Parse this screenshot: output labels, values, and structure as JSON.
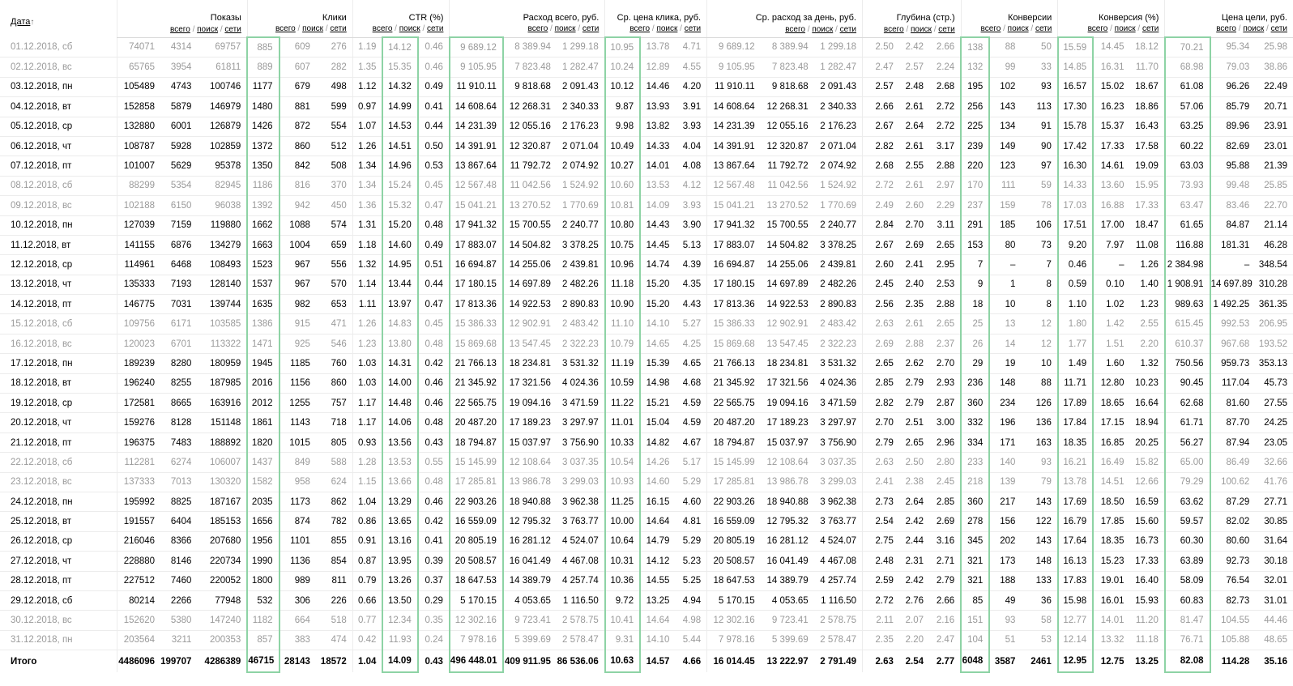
{
  "sort_arrow": "↑",
  "sub_labels": {
    "all": "всего",
    "search": "поиск",
    "net": "сети",
    "slash": "/"
  },
  "headers": [
    "Дата",
    "Показы",
    "Клики",
    "CTR (%)",
    "Расход всего, руб.",
    "Ср. цена клика, руб.",
    "Ср. расход за день, руб.",
    "Глубина (стр.)",
    "Конверсии",
    "Конверсия (%)",
    "Цена цели, руб."
  ],
  "rows": [
    {
      "w": 1,
      "c": [
        "01.12.2018, сб",
        "74071",
        "4314",
        "69757",
        "885",
        "609",
        "276",
        "1.19",
        "14.12",
        "0.46",
        "9 689.12",
        "8 389.94",
        "1 299.18",
        "10.95",
        "13.78",
        "4.71",
        "9 689.12",
        "8 389.94",
        "1 299.18",
        "2.50",
        "2.42",
        "2.66",
        "138",
        "88",
        "50",
        "15.59",
        "14.45",
        "18.12",
        "70.21",
        "95.34",
        "25.98"
      ]
    },
    {
      "w": 1,
      "c": [
        "02.12.2018, вс",
        "65765",
        "3954",
        "61811",
        "889",
        "607",
        "282",
        "1.35",
        "15.35",
        "0.46",
        "9 105.95",
        "7 823.48",
        "1 282.47",
        "10.24",
        "12.89",
        "4.55",
        "9 105.95",
        "7 823.48",
        "1 282.47",
        "2.47",
        "2.57",
        "2.24",
        "132",
        "99",
        "33",
        "14.85",
        "16.31",
        "11.70",
        "68.98",
        "79.03",
        "38.86"
      ]
    },
    {
      "w": 0,
      "c": [
        "03.12.2018, пн",
        "105489",
        "4743",
        "100746",
        "1177",
        "679",
        "498",
        "1.12",
        "14.32",
        "0.49",
        "11 910.11",
        "9 818.68",
        "2 091.43",
        "10.12",
        "14.46",
        "4.20",
        "11 910.11",
        "9 818.68",
        "2 091.43",
        "2.57",
        "2.48",
        "2.68",
        "195",
        "102",
        "93",
        "16.57",
        "15.02",
        "18.67",
        "61.08",
        "96.26",
        "22.49"
      ]
    },
    {
      "w": 0,
      "c": [
        "04.12.2018, вт",
        "152858",
        "5879",
        "146979",
        "1480",
        "881",
        "599",
        "0.97",
        "14.99",
        "0.41",
        "14 608.64",
        "12 268.31",
        "2 340.33",
        "9.87",
        "13.93",
        "3.91",
        "14 608.64",
        "12 268.31",
        "2 340.33",
        "2.66",
        "2.61",
        "2.72",
        "256",
        "143",
        "113",
        "17.30",
        "16.23",
        "18.86",
        "57.06",
        "85.79",
        "20.71"
      ]
    },
    {
      "w": 0,
      "c": [
        "05.12.2018, ср",
        "132880",
        "6001",
        "126879",
        "1426",
        "872",
        "554",
        "1.07",
        "14.53",
        "0.44",
        "14 231.39",
        "12 055.16",
        "2 176.23",
        "9.98",
        "13.82",
        "3.93",
        "14 231.39",
        "12 055.16",
        "2 176.23",
        "2.67",
        "2.64",
        "2.72",
        "225",
        "134",
        "91",
        "15.78",
        "15.37",
        "16.43",
        "63.25",
        "89.96",
        "23.91"
      ]
    },
    {
      "w": 0,
      "c": [
        "06.12.2018, чт",
        "108787",
        "5928",
        "102859",
        "1372",
        "860",
        "512",
        "1.26",
        "14.51",
        "0.50",
        "14 391.91",
        "12 320.87",
        "2 071.04",
        "10.49",
        "14.33",
        "4.04",
        "14 391.91",
        "12 320.87",
        "2 071.04",
        "2.82",
        "2.61",
        "3.17",
        "239",
        "149",
        "90",
        "17.42",
        "17.33",
        "17.58",
        "60.22",
        "82.69",
        "23.01"
      ]
    },
    {
      "w": 0,
      "c": [
        "07.12.2018, пт",
        "101007",
        "5629",
        "95378",
        "1350",
        "842",
        "508",
        "1.34",
        "14.96",
        "0.53",
        "13 867.64",
        "11 792.72",
        "2 074.92",
        "10.27",
        "14.01",
        "4.08",
        "13 867.64",
        "11 792.72",
        "2 074.92",
        "2.68",
        "2.55",
        "2.88",
        "220",
        "123",
        "97",
        "16.30",
        "14.61",
        "19.09",
        "63.03",
        "95.88",
        "21.39"
      ]
    },
    {
      "w": 1,
      "c": [
        "08.12.2018, сб",
        "88299",
        "5354",
        "82945",
        "1186",
        "816",
        "370",
        "1.34",
        "15.24",
        "0.45",
        "12 567.48",
        "11 042.56",
        "1 524.92",
        "10.60",
        "13.53",
        "4.12",
        "12 567.48",
        "11 042.56",
        "1 524.92",
        "2.72",
        "2.61",
        "2.97",
        "170",
        "111",
        "59",
        "14.33",
        "13.60",
        "15.95",
        "73.93",
        "99.48",
        "25.85"
      ]
    },
    {
      "w": 1,
      "c": [
        "09.12.2018, вс",
        "102188",
        "6150",
        "96038",
        "1392",
        "942",
        "450",
        "1.36",
        "15.32",
        "0.47",
        "15 041.21",
        "13 270.52",
        "1 770.69",
        "10.81",
        "14.09",
        "3.93",
        "15 041.21",
        "13 270.52",
        "1 770.69",
        "2.49",
        "2.60",
        "2.29",
        "237",
        "159",
        "78",
        "17.03",
        "16.88",
        "17.33",
        "63.47",
        "83.46",
        "22.70"
      ]
    },
    {
      "w": 0,
      "c": [
        "10.12.2018, пн",
        "127039",
        "7159",
        "119880",
        "1662",
        "1088",
        "574",
        "1.31",
        "15.20",
        "0.48",
        "17 941.32",
        "15 700.55",
        "2 240.77",
        "10.80",
        "14.43",
        "3.90",
        "17 941.32",
        "15 700.55",
        "2 240.77",
        "2.84",
        "2.70",
        "3.11",
        "291",
        "185",
        "106",
        "17.51",
        "17.00",
        "18.47",
        "61.65",
        "84.87",
        "21.14"
      ]
    },
    {
      "w": 0,
      "c": [
        "11.12.2018, вт",
        "141155",
        "6876",
        "134279",
        "1663",
        "1004",
        "659",
        "1.18",
        "14.60",
        "0.49",
        "17 883.07",
        "14 504.82",
        "3 378.25",
        "10.75",
        "14.45",
        "5.13",
        "17 883.07",
        "14 504.82",
        "3 378.25",
        "2.67",
        "2.69",
        "2.65",
        "153",
        "80",
        "73",
        "9.20",
        "7.97",
        "11.08",
        "116.88",
        "181.31",
        "46.28"
      ]
    },
    {
      "w": 0,
      "c": [
        "12.12.2018, ср",
        "114961",
        "6468",
        "108493",
        "1523",
        "967",
        "556",
        "1.32",
        "14.95",
        "0.51",
        "16 694.87",
        "14 255.06",
        "2 439.81",
        "10.96",
        "14.74",
        "4.39",
        "16 694.87",
        "14 255.06",
        "2 439.81",
        "2.60",
        "2.41",
        "2.95",
        "7",
        "–",
        "7",
        "0.46",
        "–",
        "1.26",
        "2 384.98",
        "–",
        "348.54"
      ]
    },
    {
      "w": 0,
      "c": [
        "13.12.2018, чт",
        "135333",
        "7193",
        "128140",
        "1537",
        "967",
        "570",
        "1.14",
        "13.44",
        "0.44",
        "17 180.15",
        "14 697.89",
        "2 482.26",
        "11.18",
        "15.20",
        "4.35",
        "17 180.15",
        "14 697.89",
        "2 482.26",
        "2.45",
        "2.40",
        "2.53",
        "9",
        "1",
        "8",
        "0.59",
        "0.10",
        "1.40",
        "1 908.91",
        "14 697.89",
        "310.28"
      ]
    },
    {
      "w": 0,
      "c": [
        "14.12.2018, пт",
        "146775",
        "7031",
        "139744",
        "1635",
        "982",
        "653",
        "1.11",
        "13.97",
        "0.47",
        "17 813.36",
        "14 922.53",
        "2 890.83",
        "10.90",
        "15.20",
        "4.43",
        "17 813.36",
        "14 922.53",
        "2 890.83",
        "2.56",
        "2.35",
        "2.88",
        "18",
        "10",
        "8",
        "1.10",
        "1.02",
        "1.23",
        "989.63",
        "1 492.25",
        "361.35"
      ]
    },
    {
      "w": 1,
      "c": [
        "15.12.2018, сб",
        "109756",
        "6171",
        "103585",
        "1386",
        "915",
        "471",
        "1.26",
        "14.83",
        "0.45",
        "15 386.33",
        "12 902.91",
        "2 483.42",
        "11.10",
        "14.10",
        "5.27",
        "15 386.33",
        "12 902.91",
        "2 483.42",
        "2.63",
        "2.61",
        "2.65",
        "25",
        "13",
        "12",
        "1.80",
        "1.42",
        "2.55",
        "615.45",
        "992.53",
        "206.95"
      ]
    },
    {
      "w": 1,
      "c": [
        "16.12.2018, вс",
        "120023",
        "6701",
        "113322",
        "1471",
        "925",
        "546",
        "1.23",
        "13.80",
        "0.48",
        "15 869.68",
        "13 547.45",
        "2 322.23",
        "10.79",
        "14.65",
        "4.25",
        "15 869.68",
        "13 547.45",
        "2 322.23",
        "2.69",
        "2.88",
        "2.37",
        "26",
        "14",
        "12",
        "1.77",
        "1.51",
        "2.20",
        "610.37",
        "967.68",
        "193.52"
      ]
    },
    {
      "w": 0,
      "c": [
        "17.12.2018, пн",
        "189239",
        "8280",
        "180959",
        "1945",
        "1185",
        "760",
        "1.03",
        "14.31",
        "0.42",
        "21 766.13",
        "18 234.81",
        "3 531.32",
        "11.19",
        "15.39",
        "4.65",
        "21 766.13",
        "18 234.81",
        "3 531.32",
        "2.65",
        "2.62",
        "2.70",
        "29",
        "19",
        "10",
        "1.49",
        "1.60",
        "1.32",
        "750.56",
        "959.73",
        "353.13"
      ]
    },
    {
      "w": 0,
      "c": [
        "18.12.2018, вт",
        "196240",
        "8255",
        "187985",
        "2016",
        "1156",
        "860",
        "1.03",
        "14.00",
        "0.46",
        "21 345.92",
        "17 321.56",
        "4 024.36",
        "10.59",
        "14.98",
        "4.68",
        "21 345.92",
        "17 321.56",
        "4 024.36",
        "2.85",
        "2.79",
        "2.93",
        "236",
        "148",
        "88",
        "11.71",
        "12.80",
        "10.23",
        "90.45",
        "117.04",
        "45.73"
      ]
    },
    {
      "w": 0,
      "c": [
        "19.12.2018, ср",
        "172581",
        "8665",
        "163916",
        "2012",
        "1255",
        "757",
        "1.17",
        "14.48",
        "0.46",
        "22 565.75",
        "19 094.16",
        "3 471.59",
        "11.22",
        "15.21",
        "4.59",
        "22 565.75",
        "19 094.16",
        "3 471.59",
        "2.82",
        "2.79",
        "2.87",
        "360",
        "234",
        "126",
        "17.89",
        "18.65",
        "16.64",
        "62.68",
        "81.60",
        "27.55"
      ]
    },
    {
      "w": 0,
      "c": [
        "20.12.2018, чт",
        "159276",
        "8128",
        "151148",
        "1861",
        "1143",
        "718",
        "1.17",
        "14.06",
        "0.48",
        "20 487.20",
        "17 189.23",
        "3 297.97",
        "11.01",
        "15.04",
        "4.59",
        "20 487.20",
        "17 189.23",
        "3 297.97",
        "2.70",
        "2.51",
        "3.00",
        "332",
        "196",
        "136",
        "17.84",
        "17.15",
        "18.94",
        "61.71",
        "87.70",
        "24.25"
      ]
    },
    {
      "w": 0,
      "c": [
        "21.12.2018, пт",
        "196375",
        "7483",
        "188892",
        "1820",
        "1015",
        "805",
        "0.93",
        "13.56",
        "0.43",
        "18 794.87",
        "15 037.97",
        "3 756.90",
        "10.33",
        "14.82",
        "4.67",
        "18 794.87",
        "15 037.97",
        "3 756.90",
        "2.79",
        "2.65",
        "2.96",
        "334",
        "171",
        "163",
        "18.35",
        "16.85",
        "20.25",
        "56.27",
        "87.94",
        "23.05"
      ]
    },
    {
      "w": 1,
      "c": [
        "22.12.2018, сб",
        "112281",
        "6274",
        "106007",
        "1437",
        "849",
        "588",
        "1.28",
        "13.53",
        "0.55",
        "15 145.99",
        "12 108.64",
        "3 037.35",
        "10.54",
        "14.26",
        "5.17",
        "15 145.99",
        "12 108.64",
        "3 037.35",
        "2.63",
        "2.50",
        "2.80",
        "233",
        "140",
        "93",
        "16.21",
        "16.49",
        "15.82",
        "65.00",
        "86.49",
        "32.66"
      ]
    },
    {
      "w": 1,
      "c": [
        "23.12.2018, вс",
        "137333",
        "7013",
        "130320",
        "1582",
        "958",
        "624",
        "1.15",
        "13.66",
        "0.48",
        "17 285.81",
        "13 986.78",
        "3 299.03",
        "10.93",
        "14.60",
        "5.29",
        "17 285.81",
        "13 986.78",
        "3 299.03",
        "2.41",
        "2.38",
        "2.45",
        "218",
        "139",
        "79",
        "13.78",
        "14.51",
        "12.66",
        "79.29",
        "100.62",
        "41.76"
      ]
    },
    {
      "w": 0,
      "c": [
        "24.12.2018, пн",
        "195992",
        "8825",
        "187167",
        "2035",
        "1173",
        "862",
        "1.04",
        "13.29",
        "0.46",
        "22 903.26",
        "18 940.88",
        "3 962.38",
        "11.25",
        "16.15",
        "4.60",
        "22 903.26",
        "18 940.88",
        "3 962.38",
        "2.73",
        "2.64",
        "2.85",
        "360",
        "217",
        "143",
        "17.69",
        "18.50",
        "16.59",
        "63.62",
        "87.29",
        "27.71"
      ]
    },
    {
      "w": 0,
      "c": [
        "25.12.2018, вт",
        "191557",
        "6404",
        "185153",
        "1656",
        "874",
        "782",
        "0.86",
        "13.65",
        "0.42",
        "16 559.09",
        "12 795.32",
        "3 763.77",
        "10.00",
        "14.64",
        "4.81",
        "16 559.09",
        "12 795.32",
        "3 763.77",
        "2.54",
        "2.42",
        "2.69",
        "278",
        "156",
        "122",
        "16.79",
        "17.85",
        "15.60",
        "59.57",
        "82.02",
        "30.85"
      ]
    },
    {
      "w": 0,
      "c": [
        "26.12.2018, ср",
        "216046",
        "8366",
        "207680",
        "1956",
        "1101",
        "855",
        "0.91",
        "13.16",
        "0.41",
        "20 805.19",
        "16 281.12",
        "4 524.07",
        "10.64",
        "14.79",
        "5.29",
        "20 805.19",
        "16 281.12",
        "4 524.07",
        "2.75",
        "2.44",
        "3.16",
        "345",
        "202",
        "143",
        "17.64",
        "18.35",
        "16.73",
        "60.30",
        "80.60",
        "31.64"
      ]
    },
    {
      "w": 0,
      "c": [
        "27.12.2018, чт",
        "228880",
        "8146",
        "220734",
        "1990",
        "1136",
        "854",
        "0.87",
        "13.95",
        "0.39",
        "20 508.57",
        "16 041.49",
        "4 467.08",
        "10.31",
        "14.12",
        "5.23",
        "20 508.57",
        "16 041.49",
        "4 467.08",
        "2.48",
        "2.31",
        "2.71",
        "321",
        "173",
        "148",
        "16.13",
        "15.23",
        "17.33",
        "63.89",
        "92.73",
        "30.18"
      ]
    },
    {
      "w": 0,
      "c": [
        "28.12.2018, пт",
        "227512",
        "7460",
        "220052",
        "1800",
        "989",
        "811",
        "0.79",
        "13.26",
        "0.37",
        "18 647.53",
        "14 389.79",
        "4 257.74",
        "10.36",
        "14.55",
        "5.25",
        "18 647.53",
        "14 389.79",
        "4 257.74",
        "2.59",
        "2.42",
        "2.79",
        "321",
        "188",
        "133",
        "17.83",
        "19.01",
        "16.40",
        "58.09",
        "76.54",
        "32.01"
      ]
    },
    {
      "w": 0,
      "c": [
        "29.12.2018, сб",
        "80214",
        "2266",
        "77948",
        "532",
        "306",
        "226",
        "0.66",
        "13.50",
        "0.29",
        "5 170.15",
        "4 053.65",
        "1 116.50",
        "9.72",
        "13.25",
        "4.94",
        "5 170.15",
        "4 053.65",
        "1 116.50",
        "2.72",
        "2.76",
        "2.66",
        "85",
        "49",
        "36",
        "15.98",
        "16.01",
        "15.93",
        "60.83",
        "82.73",
        "31.01"
      ]
    },
    {
      "w": 1,
      "c": [
        "30.12.2018, вс",
        "152620",
        "5380",
        "147240",
        "1182",
        "664",
        "518",
        "0.77",
        "12.34",
        "0.35",
        "12 302.16",
        "9 723.41",
        "2 578.75",
        "10.41",
        "14.64",
        "4.98",
        "12 302.16",
        "9 723.41",
        "2 578.75",
        "2.11",
        "2.07",
        "2.16",
        "151",
        "93",
        "58",
        "12.77",
        "14.01",
        "11.20",
        "81.47",
        "104.55",
        "44.46"
      ]
    },
    {
      "w": 1,
      "c": [
        "31.12.2018, пн",
        "203564",
        "3211",
        "200353",
        "857",
        "383",
        "474",
        "0.42",
        "11.93",
        "0.24",
        "7 978.16",
        "5 399.69",
        "2 578.47",
        "9.31",
        "14.10",
        "5.44",
        "7 978.16",
        "5 399.69",
        "2 578.47",
        "2.35",
        "2.20",
        "2.47",
        "104",
        "51",
        "53",
        "12.14",
        "13.32",
        "11.18",
        "76.71",
        "105.88",
        "48.65"
      ]
    }
  ],
  "total": {
    "c": [
      "Итого",
      "4486096",
      "199707",
      "4286389",
      "46715",
      "28143",
      "18572",
      "1.04",
      "14.09",
      "0.43",
      "496 448.01",
      "409 911.95",
      "86 536.06",
      "10.63",
      "14.57",
      "4.66",
      "16 014.45",
      "13 222.97",
      "2 791.49",
      "2.63",
      "2.54",
      "2.77",
      "6048",
      "3587",
      "2461",
      "12.95",
      "12.75",
      "13.25",
      "82.08",
      "114.28",
      "35.16"
    ]
  },
  "highlight_color": "#8ed3a5"
}
